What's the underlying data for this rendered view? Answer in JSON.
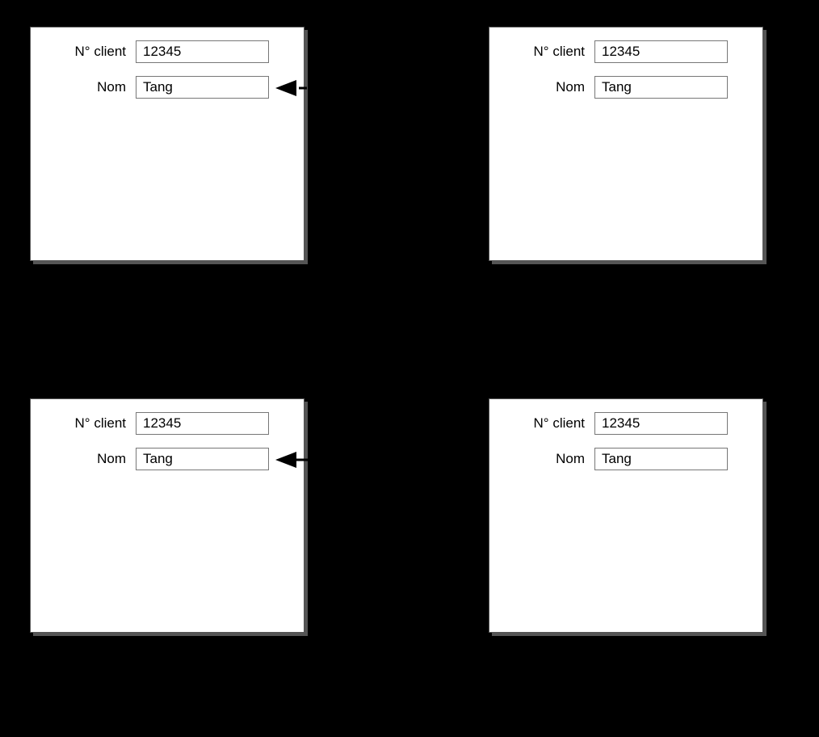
{
  "panels": {
    "tl": {
      "client_label": "N° client",
      "client_value": "12345",
      "name_label": "Nom",
      "name_value": "Tang"
    },
    "tr": {
      "client_label": "N° client",
      "client_value": "12345",
      "name_label": "Nom",
      "name_value": "Tang"
    },
    "bl": {
      "client_label": "N° client",
      "client_value": "12345",
      "name_label": "Nom",
      "name_value": "Tang"
    },
    "br": {
      "client_label": "N° client",
      "client_value": "12345",
      "name_label": "Nom",
      "name_value": "Tang"
    }
  }
}
